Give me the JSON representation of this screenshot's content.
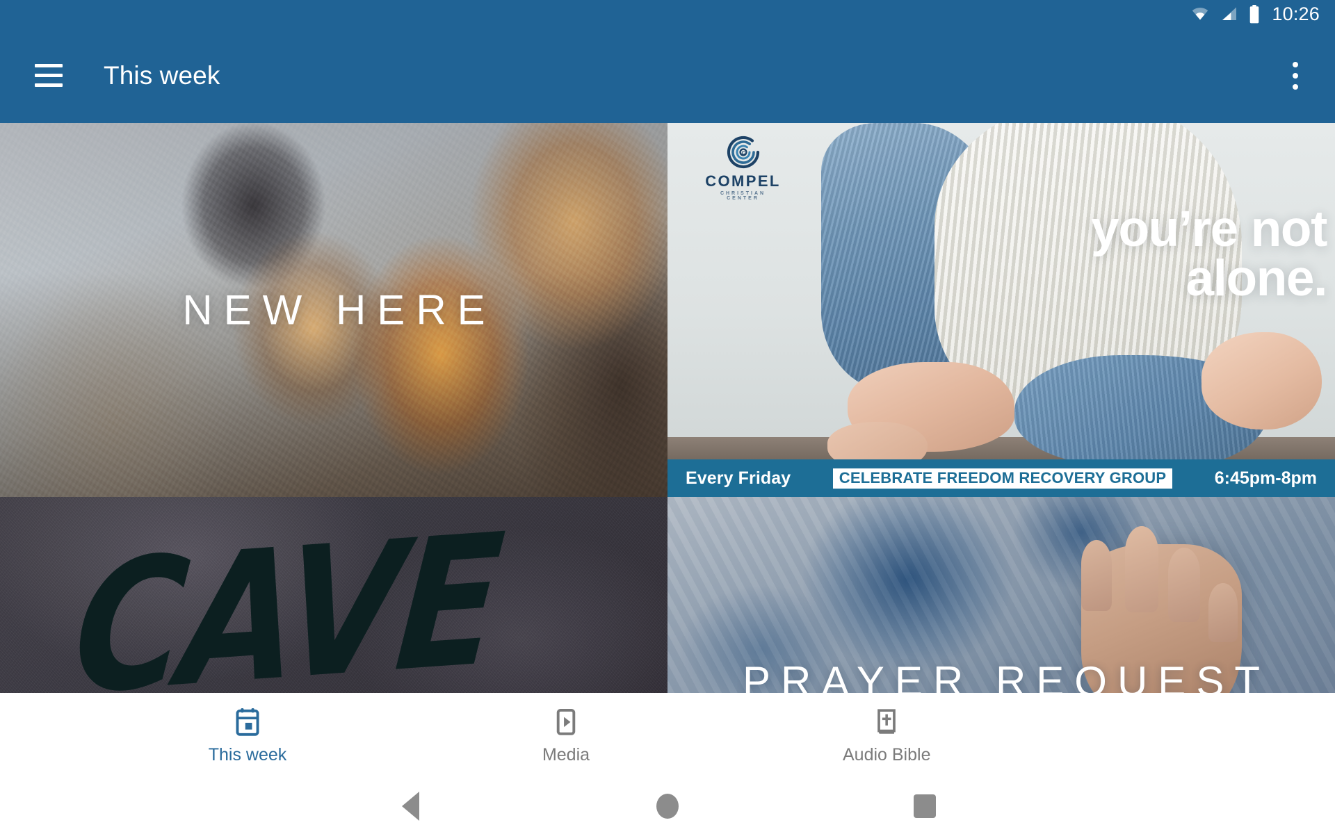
{
  "status_bar": {
    "time": "10:26",
    "icons": [
      "wifi-icon",
      "cellular-signal-icon",
      "battery-icon"
    ]
  },
  "app_bar": {
    "menu_icon": "hamburger-menu-icon",
    "title": "This week",
    "overflow_icon": "more-vertical-icon",
    "background_color": "#206395"
  },
  "cards": {
    "new_here": {
      "title": "NEW HERE"
    },
    "not_alone": {
      "logo_name": "COMPEL",
      "logo_subtitle": "CHRISTIAN CENTER",
      "headline_line1": "you’re not",
      "headline_line2": "alone.",
      "banner_left": "Every Friday",
      "banner_center": "CELEBRATE FREEDOM RECOVERY GROUP",
      "banner_right": "6:45pm-8pm",
      "banner_color": "#1d6e96"
    },
    "cave": {
      "title": "CAVE"
    },
    "prayer": {
      "title": "PRAYER REQUEST"
    }
  },
  "tab_bar": {
    "active_color": "#2a6b9c",
    "inactive_color": "#7b7b7b",
    "tabs": [
      {
        "label": "This week",
        "icon": "calendar-icon",
        "active": true
      },
      {
        "label": "Media",
        "icon": "video-play-icon",
        "active": false
      },
      {
        "label": "Audio Bible",
        "icon": "bible-icon",
        "active": false
      }
    ]
  },
  "system_nav": {
    "buttons": [
      {
        "icon": "back-triangle-icon"
      },
      {
        "icon": "home-circle-icon"
      },
      {
        "icon": "recents-square-icon"
      }
    ],
    "color": "#8c8c8c"
  }
}
